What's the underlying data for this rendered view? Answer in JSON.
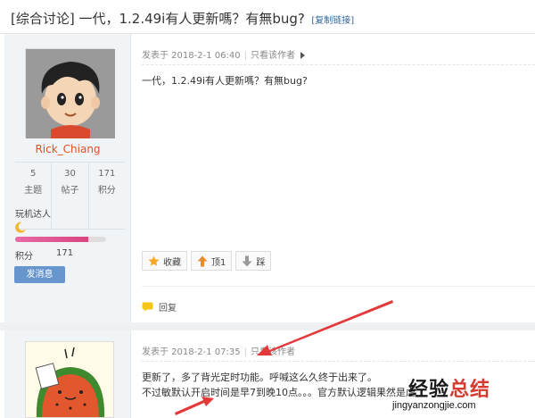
{
  "thread": {
    "title": "[综合讨论] 一代，1.2.49i有人更新嗎？有無bug?",
    "copy_link": "[复制链接]"
  },
  "post1": {
    "user": {
      "name": "Rick_Chiang",
      "stats": [
        {
          "value": "5",
          "label": "主题"
        },
        {
          "value": "30",
          "label": "帖子"
        },
        {
          "value": "171",
          "label": "积分"
        }
      ],
      "rank": "玩机达人",
      "rank_progress": 0.8,
      "points_label": "积分",
      "points_value": "171",
      "message_button": "发消息"
    },
    "meta": {
      "posted": "发表于 2018-2-1 06:40",
      "author_only": "只看该作者"
    },
    "body": "一代，1.2.49i有人更新嗎？有無bug?",
    "actions": {
      "favorite": "收藏",
      "up": "顶1",
      "down": "踩"
    },
    "reply": "回复"
  },
  "post2": {
    "meta": {
      "posted": "发表于 2018-2-1 07:35",
      "author_only": "只看该作者"
    },
    "body_line1": "更新了，多了背光定时功能。呼喊这么久终于出来了。",
    "body_line2": "不过敏默认开启时间是早7到晚10点。。。官方默认逻辑果然是虐"
  },
  "watermark": {
    "cn_part1": "经验",
    "cn_part2": "总结",
    "url": "jingyanzongjie.com"
  },
  "colors": {
    "username": "#e0501e",
    "button": "#6796cf",
    "annotation_arrow": "#e23a3a"
  }
}
